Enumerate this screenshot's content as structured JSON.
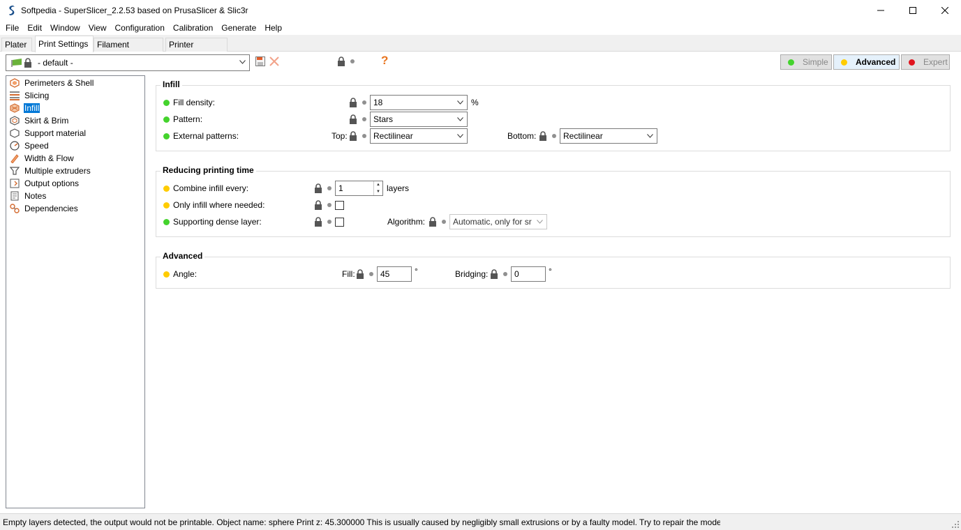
{
  "window": {
    "title": "Softpedia - SuperSlicer_2.2.53 based on PrusaSlicer & Slic3r"
  },
  "menu": [
    "File",
    "Edit",
    "Window",
    "View",
    "Configuration",
    "Calibration",
    "Generate",
    "Help"
  ],
  "tabs": [
    "Plater",
    "Print Settings",
    "Filament Settings",
    "Printer Settings"
  ],
  "active_tab": "Print Settings",
  "preset": {
    "value": "- default -"
  },
  "help_glyph": "?",
  "modes": [
    {
      "label": "Simple",
      "color": "#44d32d"
    },
    {
      "label": "Advanced",
      "color": "#ffcc00"
    },
    {
      "label": "Expert",
      "color": "#e0141e"
    }
  ],
  "sidebar": {
    "items": [
      {
        "label": "Perimeters & Shell",
        "icon": "perimeters-icon"
      },
      {
        "label": "Slicing",
        "icon": "slicing-icon"
      },
      {
        "label": "Infill",
        "icon": "infill-icon"
      },
      {
        "label": "Skirt & Brim",
        "icon": "skirt-brim-icon"
      },
      {
        "label": "Support material",
        "icon": "support-icon"
      },
      {
        "label": "Speed",
        "icon": "speed-icon"
      },
      {
        "label": "Width & Flow",
        "icon": "width-flow-icon"
      },
      {
        "label": "Multiple extruders",
        "icon": "extruders-icon"
      },
      {
        "label": "Output options",
        "icon": "output-icon"
      },
      {
        "label": "Notes",
        "icon": "notes-icon"
      },
      {
        "label": "Dependencies",
        "icon": "dependencies-icon"
      }
    ],
    "selected": "Infill"
  },
  "infill": {
    "title": "Infill",
    "fill_density": {
      "label": "Fill density:",
      "value": "18",
      "unit": "%"
    },
    "pattern": {
      "label": "Pattern:",
      "value": "Stars"
    },
    "external_patterns": {
      "label": "External patterns:",
      "top_label": "Top:",
      "top_value": "Rectilinear",
      "bottom_label": "Bottom:",
      "bottom_value": "Rectilinear"
    }
  },
  "reducing": {
    "title": "Reducing printing time",
    "combine": {
      "label": "Combine infill every:",
      "value": "1",
      "unit": "layers"
    },
    "only_infill": {
      "label": "Only infill where needed:",
      "checked": false
    },
    "supporting": {
      "label": "Supporting dense layer:",
      "checked": false,
      "algorithm_label": "Algorithm:",
      "algorithm_value": "Automatic, only for sr"
    }
  },
  "advanced": {
    "title": "Advanced",
    "angle": {
      "label": "Angle:",
      "fill_label": "Fill:",
      "fill_value": "45",
      "bridging_label": "Bridging:",
      "bridging_value": "0",
      "unit": "°"
    }
  },
  "status": {
    "text": "Empty layers detected, the output would not be printable.  Object name: sphere Print z: 45.300000  This is usually caused by negligibly small extrusions or by a faulty model. Try to repair the model or"
  }
}
